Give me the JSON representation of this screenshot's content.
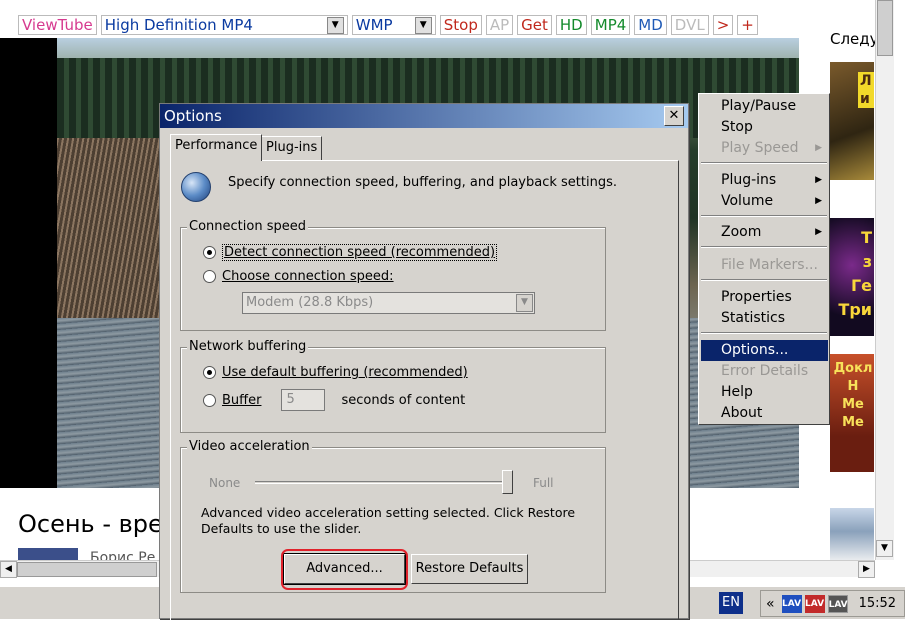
{
  "toolbar": {
    "viewtube": "ViewTube",
    "quality": "High Definition MP4",
    "player": "WMP",
    "stop": "Stop",
    "ap": "AP",
    "get": "Get",
    "hd": "HD",
    "mp4": "MP4",
    "md": "MD",
    "dvl": "DVL",
    "next": ">",
    "plus": "+"
  },
  "page": {
    "title": "Осень - вре",
    "author": "Борис Ре"
  },
  "sidebar": {
    "title": "Следу",
    "thumb1_text": "Л\nи",
    "thumb2_text": "Т\nз\nГе\nТри",
    "thumb3_text": "Докл\nН\nМе\nМе"
  },
  "dialog": {
    "title": "Options",
    "close": "✕",
    "tabs": [
      "Performance",
      "Plug-ins"
    ],
    "info": "Specify connection speed, buffering, and playback settings.",
    "connection": {
      "label": "Connection speed",
      "detect": "Detect connection speed (recommended)",
      "choose": "Choose connection speed:",
      "choice": "Modem (28.8 Kbps)"
    },
    "buffering": {
      "label": "Network buffering",
      "default": "Use default buffering (recommended)",
      "buffer": "Buffer",
      "seconds": "5",
      "suffix": "seconds of content"
    },
    "acceleration": {
      "label": "Video acceleration",
      "none": "None",
      "full": "Full",
      "level": 1.0,
      "message": "Advanced video acceleration setting selected. Click Restore Defaults to use the slider.",
      "advanced": "Advanced...",
      "restore": "Restore Defaults"
    }
  },
  "context_menu": {
    "play_pause": "Play/Pause",
    "stop": "Stop",
    "play_speed": "Play Speed",
    "plugins": "Plug-ins",
    "volume": "Volume",
    "zoom": "Zoom",
    "file_markers": "File Markers...",
    "properties": "Properties",
    "statistics": "Statistics",
    "options": "Options...",
    "error_details": "Error Details",
    "help": "Help",
    "about": "About"
  },
  "taskbar": {
    "lang": "EN",
    "chevron": "«",
    "lav1": "LAV",
    "lav2": "LAV",
    "lav3": "LAV",
    "clock": "15:52"
  },
  "colors": {
    "selection": "#0a246a",
    "dialog_bg": "#d6d3ce",
    "highlight": "#e0222b"
  }
}
